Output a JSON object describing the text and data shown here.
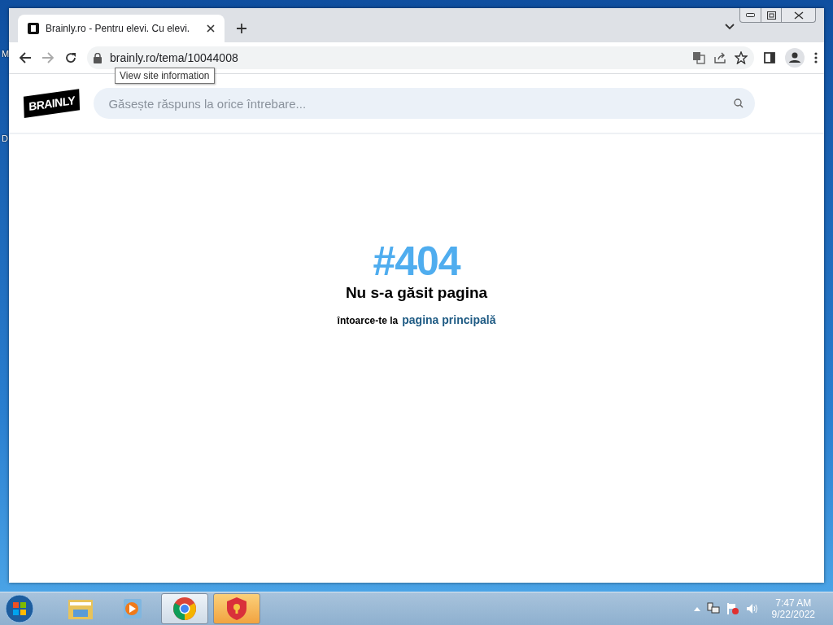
{
  "desktop": {
    "labels": [
      "M",
      "D"
    ]
  },
  "browser": {
    "tab": {
      "title": "Brainly.ro - Pentru elevi. Cu elevi.",
      "selected": true
    },
    "address": "brainly.ro/tema/10044008",
    "tooltip": "View site information"
  },
  "page": {
    "logo": "BRAINLY",
    "search": {
      "placeholder": "Găsește răspuns la orice întrebare..."
    },
    "error_code": "#404",
    "heading": "Nu s-a găsit pagina",
    "back_text": "întoarce-te la",
    "back_link": "pagina principală"
  },
  "taskbar": {
    "apps": [
      {
        "kind": "explorer",
        "selected": false
      },
      {
        "kind": "media",
        "selected": false
      },
      {
        "kind": "chrome",
        "selected": true
      },
      {
        "kind": "shield",
        "selected": true
      }
    ],
    "time": "7:47 AM",
    "date": "9/22/2022"
  }
}
